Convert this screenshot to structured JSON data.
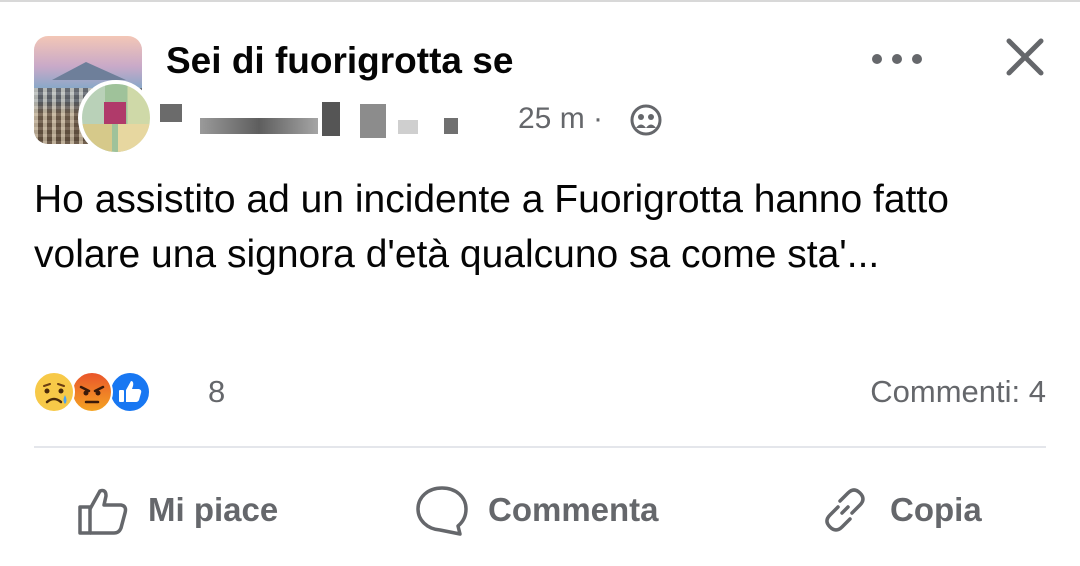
{
  "header": {
    "group_name": "Sei di fuorigrotta se",
    "time": "25 m ·"
  },
  "post": {
    "text": "Ho assistito ad un incidente a Fuorigrotta hanno fatto volare una signora d'età qualcuno sa come sta'..."
  },
  "reactions": {
    "icons": [
      "sad-emoji-icon",
      "angry-emoji-icon",
      "like-reaction-icon"
    ],
    "count": "8",
    "comments": "Commenti: 4"
  },
  "actions": {
    "like_label": "Mi piace",
    "comment_label": "Commenta",
    "copy_label": "Copia"
  },
  "colors": {
    "secondary_text": "#65676b",
    "like_blue": "#1877f2"
  }
}
